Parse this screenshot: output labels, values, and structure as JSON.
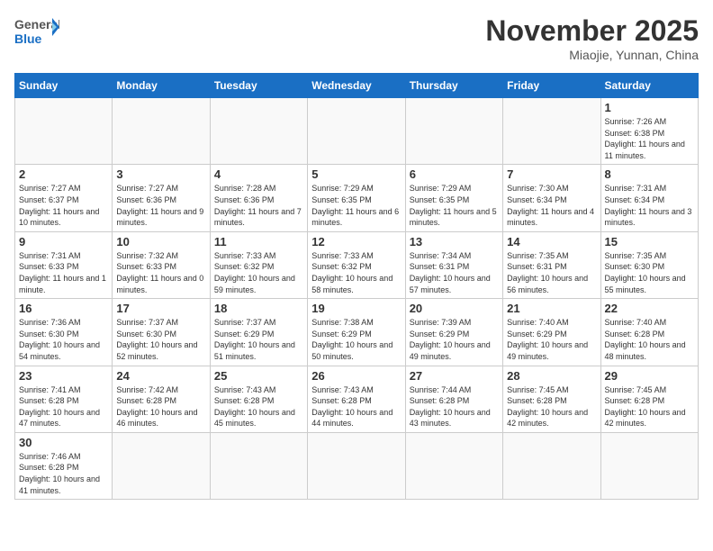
{
  "header": {
    "logo_general": "General",
    "logo_blue": "Blue",
    "month": "November 2025",
    "location": "Miaojie, Yunnan, China"
  },
  "weekdays": [
    "Sunday",
    "Monday",
    "Tuesday",
    "Wednesday",
    "Thursday",
    "Friday",
    "Saturday"
  ],
  "weeks": [
    [
      {
        "day": "",
        "info": ""
      },
      {
        "day": "",
        "info": ""
      },
      {
        "day": "",
        "info": ""
      },
      {
        "day": "",
        "info": ""
      },
      {
        "day": "",
        "info": ""
      },
      {
        "day": "",
        "info": ""
      },
      {
        "day": "1",
        "info": "Sunrise: 7:26 AM\nSunset: 6:38 PM\nDaylight: 11 hours\nand 11 minutes."
      }
    ],
    [
      {
        "day": "2",
        "info": "Sunrise: 7:27 AM\nSunset: 6:37 PM\nDaylight: 11 hours\nand 10 minutes."
      },
      {
        "day": "3",
        "info": "Sunrise: 7:27 AM\nSunset: 6:36 PM\nDaylight: 11 hours\nand 9 minutes."
      },
      {
        "day": "4",
        "info": "Sunrise: 7:28 AM\nSunset: 6:36 PM\nDaylight: 11 hours\nand 7 minutes."
      },
      {
        "day": "5",
        "info": "Sunrise: 7:29 AM\nSunset: 6:35 PM\nDaylight: 11 hours\nand 6 minutes."
      },
      {
        "day": "6",
        "info": "Sunrise: 7:29 AM\nSunset: 6:35 PM\nDaylight: 11 hours\nand 5 minutes."
      },
      {
        "day": "7",
        "info": "Sunrise: 7:30 AM\nSunset: 6:34 PM\nDaylight: 11 hours\nand 4 minutes."
      },
      {
        "day": "8",
        "info": "Sunrise: 7:31 AM\nSunset: 6:34 PM\nDaylight: 11 hours\nand 3 minutes."
      }
    ],
    [
      {
        "day": "9",
        "info": "Sunrise: 7:31 AM\nSunset: 6:33 PM\nDaylight: 11 hours\nand 1 minute."
      },
      {
        "day": "10",
        "info": "Sunrise: 7:32 AM\nSunset: 6:33 PM\nDaylight: 11 hours\nand 0 minutes."
      },
      {
        "day": "11",
        "info": "Sunrise: 7:33 AM\nSunset: 6:32 PM\nDaylight: 10 hours\nand 59 minutes."
      },
      {
        "day": "12",
        "info": "Sunrise: 7:33 AM\nSunset: 6:32 PM\nDaylight: 10 hours\nand 58 minutes."
      },
      {
        "day": "13",
        "info": "Sunrise: 7:34 AM\nSunset: 6:31 PM\nDaylight: 10 hours\nand 57 minutes."
      },
      {
        "day": "14",
        "info": "Sunrise: 7:35 AM\nSunset: 6:31 PM\nDaylight: 10 hours\nand 56 minutes."
      },
      {
        "day": "15",
        "info": "Sunrise: 7:35 AM\nSunset: 6:30 PM\nDaylight: 10 hours\nand 55 minutes."
      }
    ],
    [
      {
        "day": "16",
        "info": "Sunrise: 7:36 AM\nSunset: 6:30 PM\nDaylight: 10 hours\nand 54 minutes."
      },
      {
        "day": "17",
        "info": "Sunrise: 7:37 AM\nSunset: 6:30 PM\nDaylight: 10 hours\nand 52 minutes."
      },
      {
        "day": "18",
        "info": "Sunrise: 7:37 AM\nSunset: 6:29 PM\nDaylight: 10 hours\nand 51 minutes."
      },
      {
        "day": "19",
        "info": "Sunrise: 7:38 AM\nSunset: 6:29 PM\nDaylight: 10 hours\nand 50 minutes."
      },
      {
        "day": "20",
        "info": "Sunrise: 7:39 AM\nSunset: 6:29 PM\nDaylight: 10 hours\nand 49 minutes."
      },
      {
        "day": "21",
        "info": "Sunrise: 7:40 AM\nSunset: 6:29 PM\nDaylight: 10 hours\nand 49 minutes."
      },
      {
        "day": "22",
        "info": "Sunrise: 7:40 AM\nSunset: 6:28 PM\nDaylight: 10 hours\nand 48 minutes."
      }
    ],
    [
      {
        "day": "23",
        "info": "Sunrise: 7:41 AM\nSunset: 6:28 PM\nDaylight: 10 hours\nand 47 minutes."
      },
      {
        "day": "24",
        "info": "Sunrise: 7:42 AM\nSunset: 6:28 PM\nDaylight: 10 hours\nand 46 minutes."
      },
      {
        "day": "25",
        "info": "Sunrise: 7:43 AM\nSunset: 6:28 PM\nDaylight: 10 hours\nand 45 minutes."
      },
      {
        "day": "26",
        "info": "Sunrise: 7:43 AM\nSunset: 6:28 PM\nDaylight: 10 hours\nand 44 minutes."
      },
      {
        "day": "27",
        "info": "Sunrise: 7:44 AM\nSunset: 6:28 PM\nDaylight: 10 hours\nand 43 minutes."
      },
      {
        "day": "28",
        "info": "Sunrise: 7:45 AM\nSunset: 6:28 PM\nDaylight: 10 hours\nand 42 minutes."
      },
      {
        "day": "29",
        "info": "Sunrise: 7:45 AM\nSunset: 6:28 PM\nDaylight: 10 hours\nand 42 minutes."
      }
    ],
    [
      {
        "day": "30",
        "info": "Sunrise: 7:46 AM\nSunset: 6:28 PM\nDaylight: 10 hours\nand 41 minutes."
      },
      {
        "day": "",
        "info": ""
      },
      {
        "day": "",
        "info": ""
      },
      {
        "day": "",
        "info": ""
      },
      {
        "day": "",
        "info": ""
      },
      {
        "day": "",
        "info": ""
      },
      {
        "day": "",
        "info": ""
      }
    ]
  ]
}
